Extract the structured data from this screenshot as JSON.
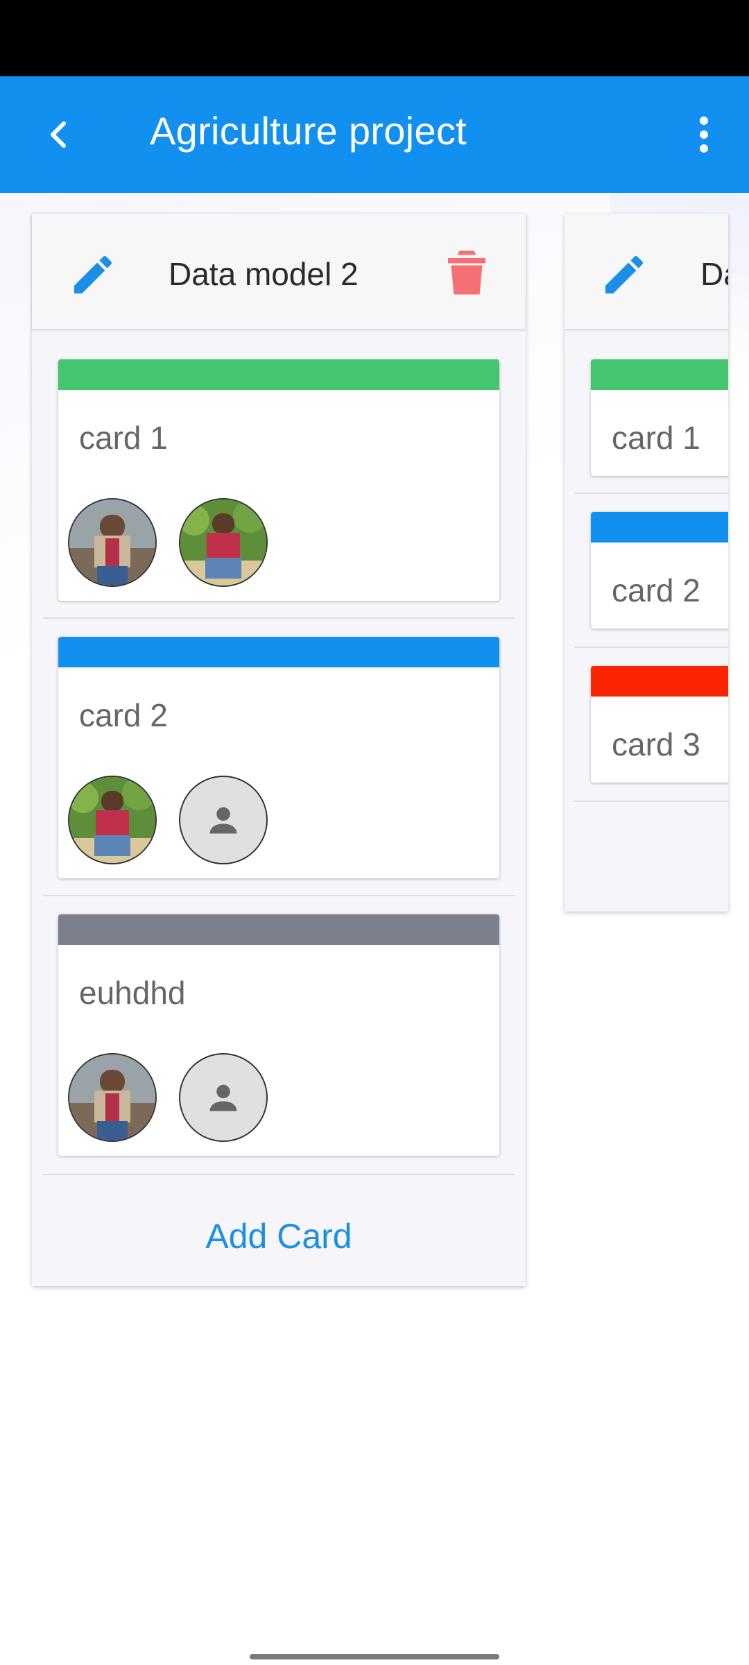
{
  "app_bar": {
    "title": "Agriculture project",
    "background_color": "#1190ef",
    "back_icon": "chevron-left-icon",
    "menu_icon": "more-vert-icon"
  },
  "columns": [
    {
      "title": "Data model 2",
      "edit_icon": "pencil-icon",
      "delete_icon": "trash-icon",
      "add_card_label": "Add Card",
      "cards": [
        {
          "title": "card 1",
          "label_color": "#43c66e",
          "members": [
            "photo",
            "photo"
          ]
        },
        {
          "title": "card 2",
          "label_color": "#1190ef",
          "members": [
            "photo",
            "placeholder"
          ]
        },
        {
          "title": "euhdhd",
          "label_color": "#7b808b",
          "members": [
            "photo",
            "placeholder"
          ]
        }
      ]
    },
    {
      "title": "Da",
      "edit_icon": "pencil-icon",
      "cards": [
        {
          "title": "card 1",
          "label_color": "#43c66e"
        },
        {
          "title": "card 2",
          "label_color": "#1190ef"
        },
        {
          "title": "card 3",
          "label_color": "#fb2400"
        }
      ]
    }
  ],
  "colors": {
    "accent": "#1b8fe8",
    "delete": "#f47074",
    "edit": "#1b8fe8"
  }
}
